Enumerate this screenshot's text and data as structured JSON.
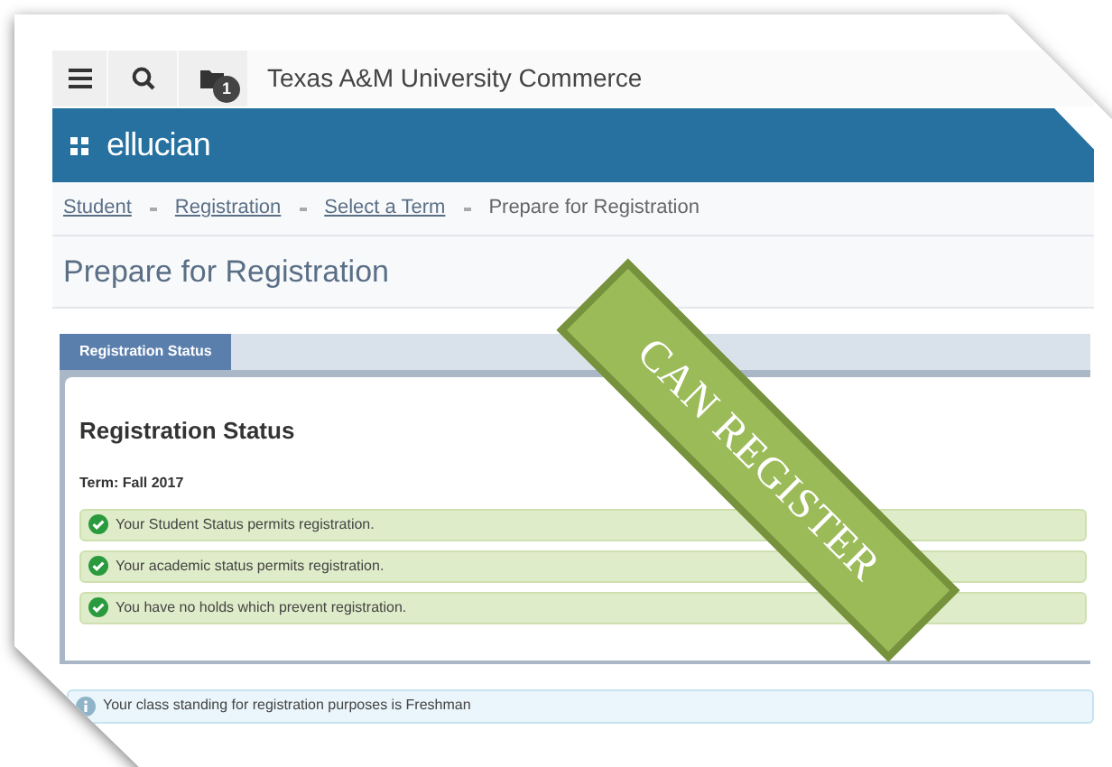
{
  "header": {
    "title": "Texas A&M University Commerce",
    "badge": "1"
  },
  "brand": {
    "name": "ellucian"
  },
  "breadcrumbs": [
    {
      "label": "Student",
      "kind": "link"
    },
    {
      "label": "Registration",
      "kind": "link"
    },
    {
      "label": "Select a Term",
      "kind": "link"
    },
    {
      "label": "Prepare for Registration",
      "kind": "current"
    }
  ],
  "page_title": "Prepare for Registration",
  "tabs": [
    {
      "label": "Registration Status",
      "selected": true
    }
  ],
  "panel": {
    "heading": "Registration Status",
    "term": "Term: Fall 2017",
    "messages": [
      {
        "kind": "success",
        "text": "Your Student Status permits registration."
      },
      {
        "kind": "success",
        "text": "Your academic status permits registration."
      },
      {
        "kind": "success",
        "text": "You have no holds which prevent registration."
      },
      {
        "kind": "info",
        "text": "Your class standing for registration purposes is Freshman"
      }
    ]
  },
  "stamp": {
    "text": "CAN REGISTER"
  }
}
